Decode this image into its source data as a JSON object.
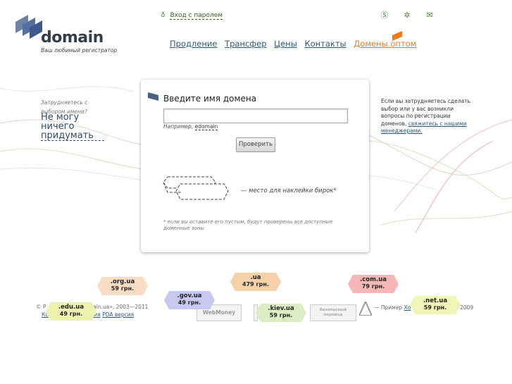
{
  "brand": {
    "name": "domain",
    "tagline": "Ваш любимый регистратор"
  },
  "header": {
    "login_label": "Вход с паролем",
    "nav": [
      {
        "label": "Продление"
      },
      {
        "label": "Трансфер"
      },
      {
        "label": "Цены"
      },
      {
        "label": "Контакты"
      },
      {
        "label": "Домены оптом"
      }
    ]
  },
  "left_help": {
    "small": "Затрудняетесь с выбором имени?",
    "big": "Не могу ничего придумать"
  },
  "search": {
    "title": "Введите имя домена",
    "input_value": "",
    "example_prefix": "Например,",
    "example_value": "edomain",
    "button_label": "Проверить",
    "tags_note": "— место для наклейки бирок*",
    "footnote": "* если вы оставите его пустым, будут проверены все доступные доменные зоны"
  },
  "right_help": {
    "text": "Если вы затрудняетесь сделать выбор или у вас возникли вопросы по регистрации доменов,",
    "link": "свяжитесь с нашими менеджерами."
  },
  "footer": {
    "line1_start": "© Р",
    "line1_mid": "ain.ua», 2003—2011",
    "line2_start": "Ко",
    "line2_mid": "ация",
    "line2_link": "PDA версия",
    "partner_webmoney": "WebMoney",
    "partner_other": "Безопасный перевод",
    "right_prefix": "— Пример",
    "right_link": "Хо",
    "right_year": "2009"
  },
  "price_tags": [
    {
      "zone": ".org.ua",
      "price": "59 грн.",
      "color": "#f8dcc4"
    },
    {
      "zone": ".gov.ua",
      "price": "49 грн.",
      "color": "#c8c8f0"
    },
    {
      "zone": ".ua",
      "price": "479 грн.",
      "color": "#f6d0a6"
    },
    {
      "zone": ".com.ua",
      "price": "79 грн.",
      "color": "#f4b6b6"
    },
    {
      "zone": ".edu.ua",
      "price": "49 грн.",
      "color": "#ecf2b0"
    },
    {
      "zone": ".kiev.ua",
      "price": "59 грн.",
      "color": "#dcedc4"
    },
    {
      "zone": ".net.ua",
      "price": "59 грн.",
      "color": "#f0f6b8"
    }
  ],
  "colors": {
    "accent": "#f07a1a",
    "link": "#2b5a7a",
    "logo": "#4a6080"
  }
}
